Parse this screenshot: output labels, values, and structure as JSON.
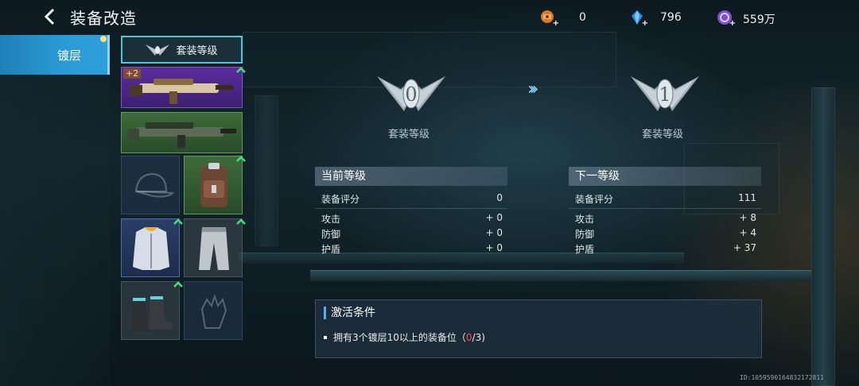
{
  "header": {
    "title": "装备改造",
    "currencies": [
      {
        "icon": "orange-crate-icon",
        "value": "0"
      },
      {
        "icon": "blue-crystal-icon",
        "value": "796"
      },
      {
        "icon": "purple-coin-icon",
        "value": "559万"
      }
    ]
  },
  "sidebar": {
    "tabs": [
      {
        "label": "镀层",
        "active": true
      }
    ]
  },
  "equipment": {
    "suit_button_label": "套装等级",
    "weapon1_badge": "+2"
  },
  "levels": {
    "current": {
      "numeral": "0",
      "caption": "套装等级"
    },
    "next": {
      "numeral": "1",
      "caption": "套装等级"
    }
  },
  "stats": {
    "current": {
      "title": "当前等级",
      "rows": [
        {
          "label": "装备评分",
          "value": "0"
        },
        {
          "label": "攻击",
          "value": "+ 0"
        },
        {
          "label": "防御",
          "value": "+ 0"
        },
        {
          "label": "护盾",
          "value": "+ 0"
        }
      ]
    },
    "next": {
      "title": "下一等级",
      "rows": [
        {
          "label": "装备评分",
          "value": "111"
        },
        {
          "label": "攻击",
          "value": "+ 8"
        },
        {
          "label": "防御",
          "value": "+ 4"
        },
        {
          "label": "护盾",
          "value": "+ 37"
        }
      ]
    }
  },
  "activation": {
    "title": "激活条件",
    "condition_text": "拥有3个镀层10以上的装备位（",
    "progress_current": "0",
    "progress_total": "/3)",
    "progress_fraction": 0
  },
  "footer": {
    "uid": "ID:1059590164832172811"
  },
  "colors": {
    "accent_blue": "#2a9bd6",
    "rarity_purple": "#5b2d9e",
    "rarity_green": "#3e6b3b",
    "rarity_blue": "#2a3f66",
    "warning_red": "#ff4a4a"
  }
}
